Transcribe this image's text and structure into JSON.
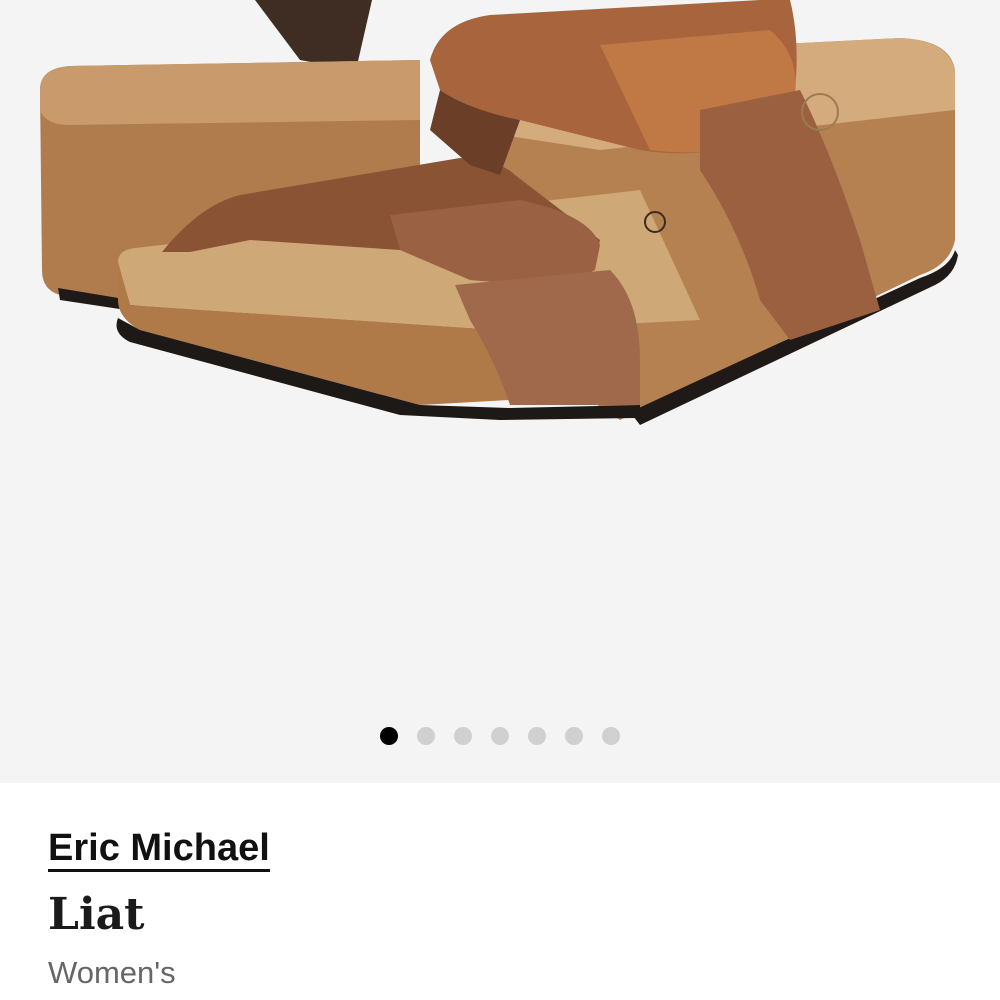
{
  "gallery": {
    "image_subject": "brown leather two-strap cork wedge slide sandals",
    "slide_count": 7,
    "active_slide": 1,
    "colors": {
      "background": "#f4f4f4",
      "active_dot": "#000000",
      "inactive_dot": "#d0d0d0"
    }
  },
  "product": {
    "brand": "Eric Michael",
    "name": "Liat",
    "gender": "Women's"
  }
}
